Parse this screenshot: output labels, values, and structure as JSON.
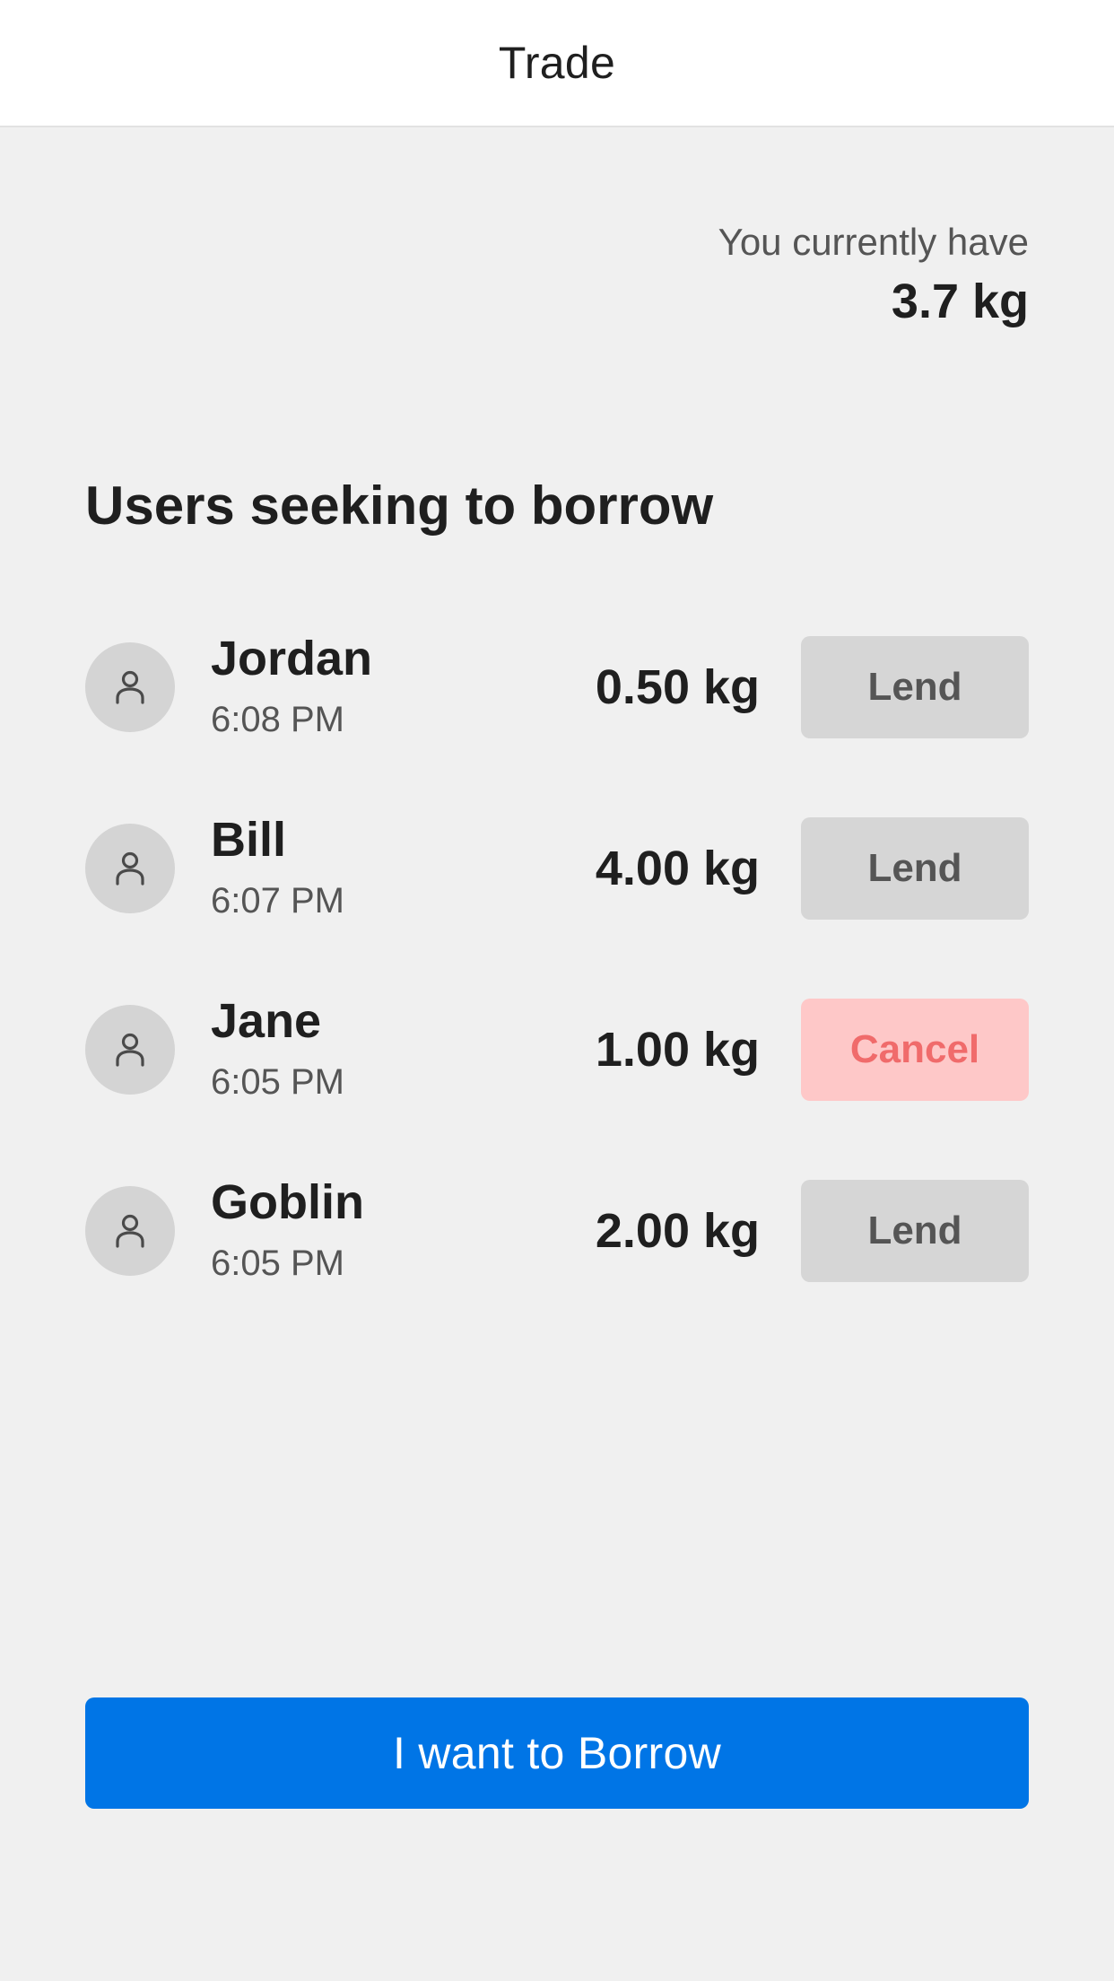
{
  "header": {
    "title": "Trade"
  },
  "balance": {
    "label": "You currently have",
    "value": "3.7 kg"
  },
  "section": {
    "title": "Users seeking to borrow"
  },
  "requests": [
    {
      "name": "Jordan",
      "time": "6:08 PM",
      "amount": "0.50 kg",
      "action": "Lend",
      "action_type": "lend"
    },
    {
      "name": "Bill",
      "time": "6:07 PM",
      "amount": "4.00 kg",
      "action": "Lend",
      "action_type": "lend"
    },
    {
      "name": "Jane",
      "time": "6:05 PM",
      "amount": "1.00 kg",
      "action": "Cancel",
      "action_type": "cancel"
    },
    {
      "name": "Goblin",
      "time": "6:05 PM",
      "amount": "2.00 kg",
      "action": "Lend",
      "action_type": "lend"
    }
  ],
  "footer": {
    "borrow_label": "I want to Borrow"
  },
  "icons": {
    "avatar": "person-icon"
  },
  "colors": {
    "primary": "#0075e6",
    "lend_button_bg": "#d6d6d6",
    "cancel_button_bg": "#fec8c8",
    "cancel_button_text": "#f06b6b"
  }
}
